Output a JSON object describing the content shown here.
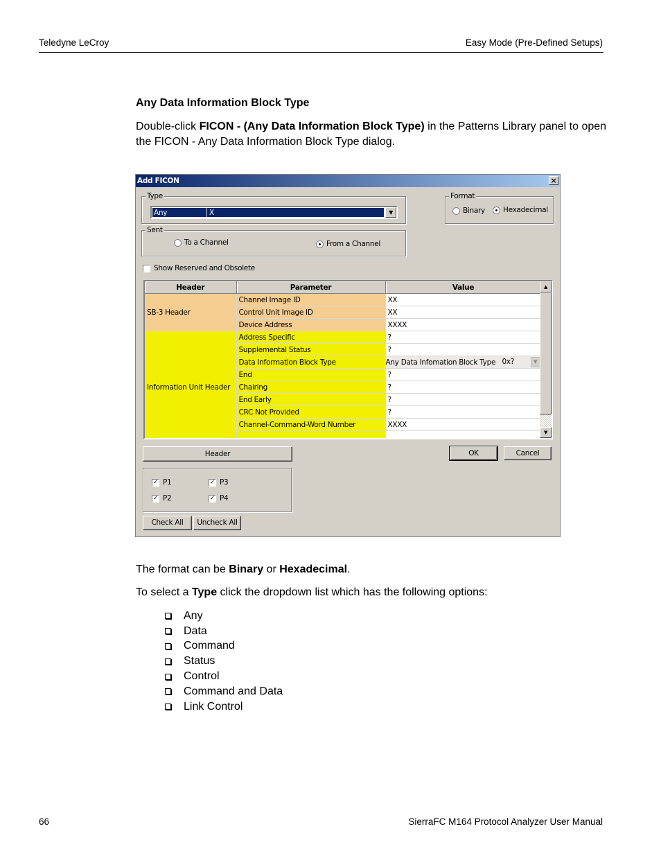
{
  "page_header": {
    "left": "Teledyne LeCroy",
    "right": "Easy Mode (Pre-Defined Setups)"
  },
  "section_title": "Any Data Information Block Type",
  "intro": {
    "prefix": "Double-click ",
    "bold": "FICON - (Any Data Information Block Type)",
    "suffix": " in the Patterns Library panel to open the FICON - Any Data Information Block Type dialog."
  },
  "dialog": {
    "title": "Add FICON",
    "close_icon": "close-icon",
    "type_group": {
      "label": "Type",
      "selected_col1": "Any",
      "selected_col2": "X"
    },
    "format_group": {
      "label": "Format",
      "options": [
        {
          "label": "Binary",
          "selected": false
        },
        {
          "label": "Hexadecimal",
          "selected": true
        }
      ]
    },
    "sent_group": {
      "label": "Sent",
      "options": [
        {
          "label": "To a Channel",
          "selected": false
        },
        {
          "label": "From a Channel",
          "selected": true
        }
      ]
    },
    "show_reserved": {
      "label": "Show Reserved and Obsolete",
      "checked": false
    },
    "grid": {
      "columns": [
        "Header",
        "Parameter",
        "Value"
      ],
      "groups": [
        {
          "header": "SB-3 Header",
          "color": "#f5cd90",
          "rows": [
            {
              "parameter": "Channel Image ID",
              "value": "XX"
            },
            {
              "parameter": "Control Unit Image ID",
              "value": "XX"
            },
            {
              "parameter": "Device Address",
              "value": "XXXX"
            }
          ]
        },
        {
          "header": "Information Unit Header",
          "color": "#f0f000",
          "rows": [
            {
              "parameter": "Address Specific",
              "value": "?"
            },
            {
              "parameter": "Supplemental Status",
              "value": "?"
            },
            {
              "parameter": "Data Information Block Type",
              "value": "Any Data Infomation Block Type",
              "value2": "0x?"
            },
            {
              "parameter": "End",
              "value": "?"
            },
            {
              "parameter": "Chairing",
              "value": "?"
            },
            {
              "parameter": "End Early",
              "value": "?"
            },
            {
              "parameter": "CRC Not Provided",
              "value": "?"
            },
            {
              "parameter": "Channel-Command-Word Number",
              "value": "XXXX"
            }
          ]
        }
      ]
    },
    "header_button": "Header",
    "ok_button": "OK",
    "cancel_button": "Cancel",
    "ports": [
      {
        "label": "P1",
        "checked": true
      },
      {
        "label": "P2",
        "checked": true
      },
      {
        "label": "P3",
        "checked": true
      },
      {
        "label": "P4",
        "checked": true
      }
    ],
    "check_all_button": "Check All",
    "uncheck_all_button": "Uncheck All"
  },
  "format_text": {
    "prefix": "The format can be ",
    "b1": "Binary",
    "mid": " or ",
    "b2": "Hexadecimal",
    "suffix": "."
  },
  "type_text": {
    "prefix": "To select a ",
    "bold": "Type",
    "suffix": " click the dropdown list which has the following options:"
  },
  "type_options": [
    "Any",
    "Data",
    "Command",
    "Status",
    "Control",
    "Command and Data",
    "Link Control"
  ],
  "page_footer": {
    "page_number": "66",
    "manual_title": "SierraFC M164 Protocol Analyzer User Manual"
  }
}
